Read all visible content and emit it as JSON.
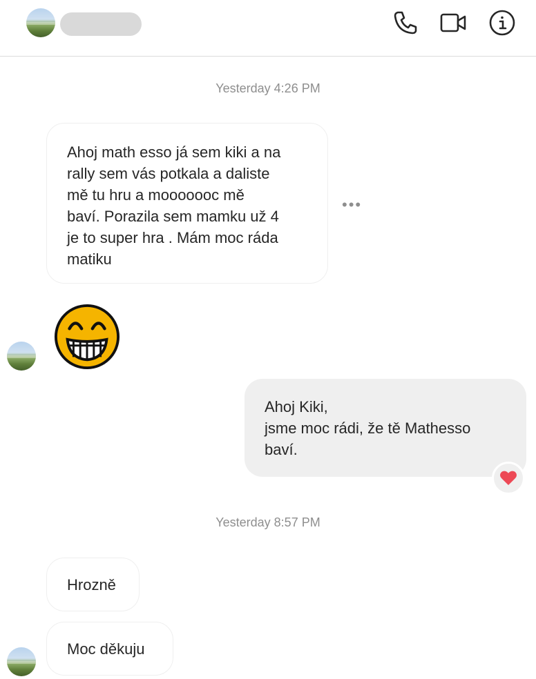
{
  "header": {
    "icons": [
      "phone-icon",
      "video-camera-icon",
      "info-icon"
    ]
  },
  "conversation": {
    "timestamp_1": "Yesterday 4:26 PM",
    "message_1_lines": [
      "Ahoj math esso já sem kiki a na",
      "rally sem vás potkala a daliste",
      "mě tu hru a mooooooc mě",
      "baví. Porazila sem mamku už 4",
      "je to super hra . Mám moc ráda",
      "matiku"
    ],
    "more_options": "•••",
    "emoji_name": "grinning-face-emoji",
    "reply_lines": [
      "Ahoj Kiki,",
      "jsme moc rádi, že tě Mathesso",
      "baví."
    ],
    "reaction": "heart-icon",
    "timestamp_2": "Yesterday 8:57 PM",
    "message_3": "Hrozně",
    "message_4": "Moc děkuju"
  },
  "colors": {
    "outgoing_bubble": "#efefef",
    "incoming_bubble_border": "#efefef",
    "timestamp": "#8e8e8e",
    "heart": "#ed4956",
    "emoji_face": "#f5b400"
  }
}
